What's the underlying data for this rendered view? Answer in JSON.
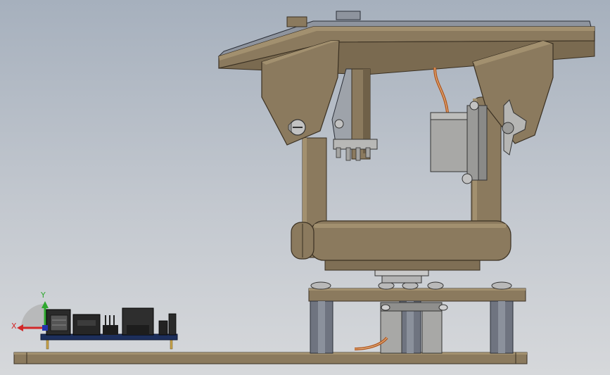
{
  "viewport": {
    "background_top": "#a6b0bd",
    "background_bottom": "#d6d8db"
  },
  "colors": {
    "wood": "#8b7a5e",
    "wood_light": "#a2906f",
    "wood_dark": "#6a5b44",
    "wood_edge": "#3a3022",
    "servo_body": "#a8a8a6",
    "servo_dark": "#7e7e7c",
    "pillar": "#6f7480",
    "pcb": "#1d2f5c",
    "wire": "#b1561e",
    "axis_x": "#d22828",
    "axis_y": "#2fa82f",
    "axis_z": "#2233aa"
  },
  "triad": {
    "x_label": "X",
    "y_label": "Y"
  }
}
